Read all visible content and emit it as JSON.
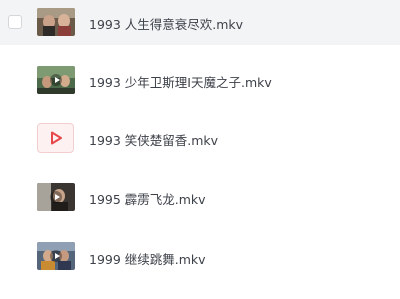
{
  "files": [
    {
      "name": "1993 人生得意衰尽欢.mkv",
      "thumb": "video-thumbnail",
      "hovered": true
    },
    {
      "name": "1993 少年卫斯理I天魔之子.mkv",
      "thumb": "video-thumbnail",
      "hovered": false
    },
    {
      "name": "1993 笑侠楚留香.mkv",
      "thumb": "video-file-icon",
      "hovered": false
    },
    {
      "name": "1995 霹雳飞龙.mkv",
      "thumb": "video-thumbnail",
      "hovered": false
    },
    {
      "name": "1999 继续跳舞.mkv",
      "thumb": "video-thumbnail",
      "hovered": false
    }
  ],
  "colors": {
    "text": "#3d4149",
    "hover_bg": "#f3f4f6",
    "video_icon_red": "#e8474a",
    "video_icon_bg": "#fdf1f1"
  }
}
